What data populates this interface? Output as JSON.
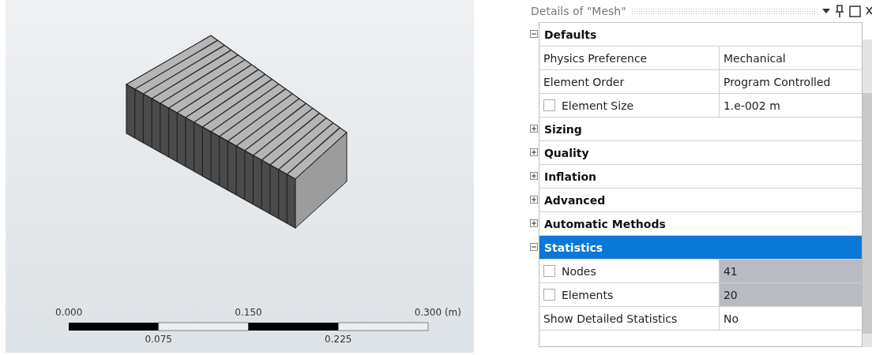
{
  "scale_bar": {
    "top_labels": [
      "0.000",
      "0.150",
      "0.300 (m)"
    ],
    "bottom_labels": [
      "0.075",
      "0.225"
    ]
  },
  "details_panel": {
    "title": "Details of \"Mesh\"",
    "sections": [
      {
        "label": "Defaults",
        "expanded": true,
        "selected": false,
        "rows": [
          {
            "name": "Physics Preference",
            "value": "Mechanical",
            "kind": "plain",
            "readonly": false
          },
          {
            "name": "Element Order",
            "value": "Program Controlled",
            "kind": "plain",
            "readonly": false
          },
          {
            "name": "Element Size",
            "value": "1.e-002 m",
            "kind": "checkbox",
            "checked": false,
            "readonly": false
          }
        ]
      },
      {
        "label": "Sizing",
        "expanded": false,
        "selected": false
      },
      {
        "label": "Quality",
        "expanded": false,
        "selected": false
      },
      {
        "label": "Inflation",
        "expanded": false,
        "selected": false
      },
      {
        "label": "Advanced",
        "expanded": false,
        "selected": false
      },
      {
        "label": "Automatic Methods",
        "expanded": false,
        "selected": false
      },
      {
        "label": "Statistics",
        "expanded": true,
        "selected": true,
        "rows": [
          {
            "name": "Nodes",
            "value": "41",
            "kind": "checkbox",
            "checked": false,
            "readonly": true
          },
          {
            "name": "Elements",
            "value": "20",
            "kind": "checkbox",
            "checked": false,
            "readonly": true
          },
          {
            "name": "Show Detailed Statistics",
            "value": "No",
            "kind": "plain",
            "readonly": false
          }
        ]
      }
    ]
  }
}
